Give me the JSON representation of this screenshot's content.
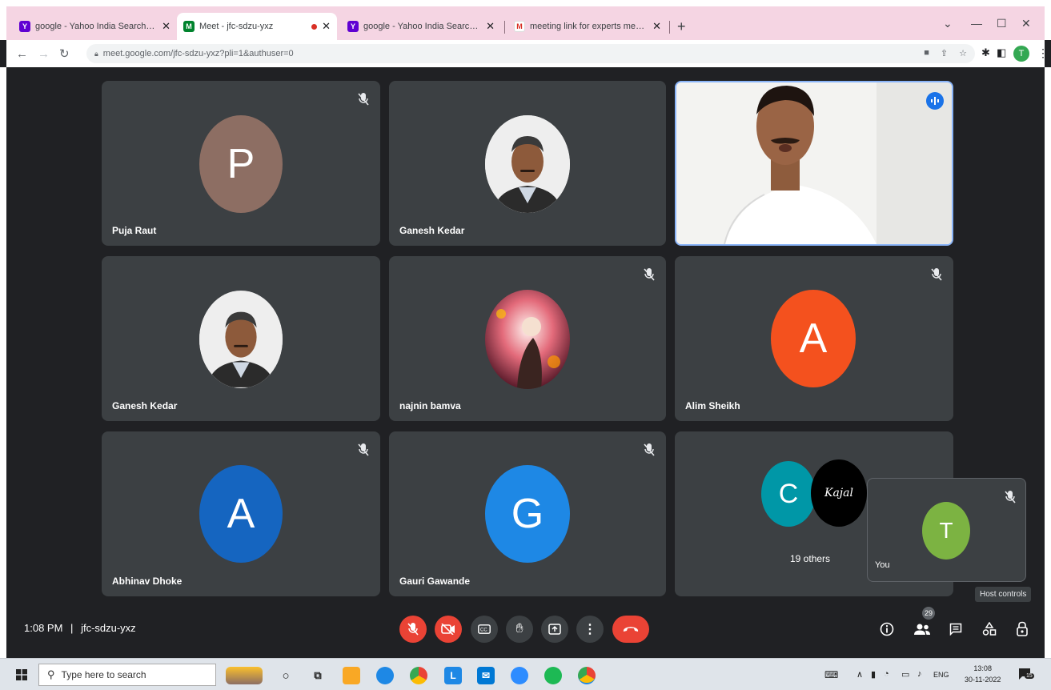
{
  "browser": {
    "tabs": [
      {
        "label": "google - Yahoo India Search Res",
        "favicon": "Y",
        "close": "✕"
      },
      {
        "label": "Meet - jfc-sdzu-yxz",
        "favicon": "M",
        "close": "✕",
        "active": true
      },
      {
        "label": "google - Yahoo India Search Res",
        "favicon": "Y",
        "close": "✕"
      },
      {
        "label": "meeting link for experts meet - ",
        "favicon": "M",
        "close": "✕"
      }
    ],
    "new_tab": "+",
    "url": "meet.google.com/jfc-sdzu-yxz?pli=1&authuser=0",
    "profile_initial": "T"
  },
  "participants": [
    {
      "name": "Puja Raut",
      "type": "initial",
      "initial": "P",
      "color": "#8d6e63",
      "muted": true
    },
    {
      "name": "Ganesh Kedar",
      "type": "photo",
      "muted": false
    },
    {
      "name": "",
      "type": "video",
      "speaking": true
    },
    {
      "name": "Ganesh Kedar",
      "type": "photo",
      "muted": false
    },
    {
      "name": "najnin bamva",
      "type": "photo",
      "muted": true
    },
    {
      "name": "Alim Sheikh",
      "type": "initial",
      "initial": "A",
      "color": "#f4511e",
      "muted": true
    },
    {
      "name": "Abhinav Dhoke",
      "type": "initial",
      "initial": "A",
      "color": "#1565c0",
      "muted": true
    },
    {
      "name": "Gauri Gawande",
      "type": "initial",
      "initial": "G",
      "color": "#1e88e5",
      "muted": true
    },
    {
      "name": "19 others",
      "type": "group",
      "initial": "C",
      "color": "#0097a7",
      "second_sig": "Kajal"
    }
  ],
  "self_view": {
    "name": "You",
    "initial": "T",
    "color": "#7cb342"
  },
  "meeting": {
    "time": "1:08 PM",
    "separator": "|",
    "code": "jfc-sdzu-yxz"
  },
  "controls": {
    "people_count": "29",
    "tooltip": "Host controls"
  },
  "taskbar": {
    "search_placeholder": "Type here to search",
    "lang": "ENG",
    "time": "13:08",
    "date": "30-11-2022",
    "notifications": "15"
  }
}
